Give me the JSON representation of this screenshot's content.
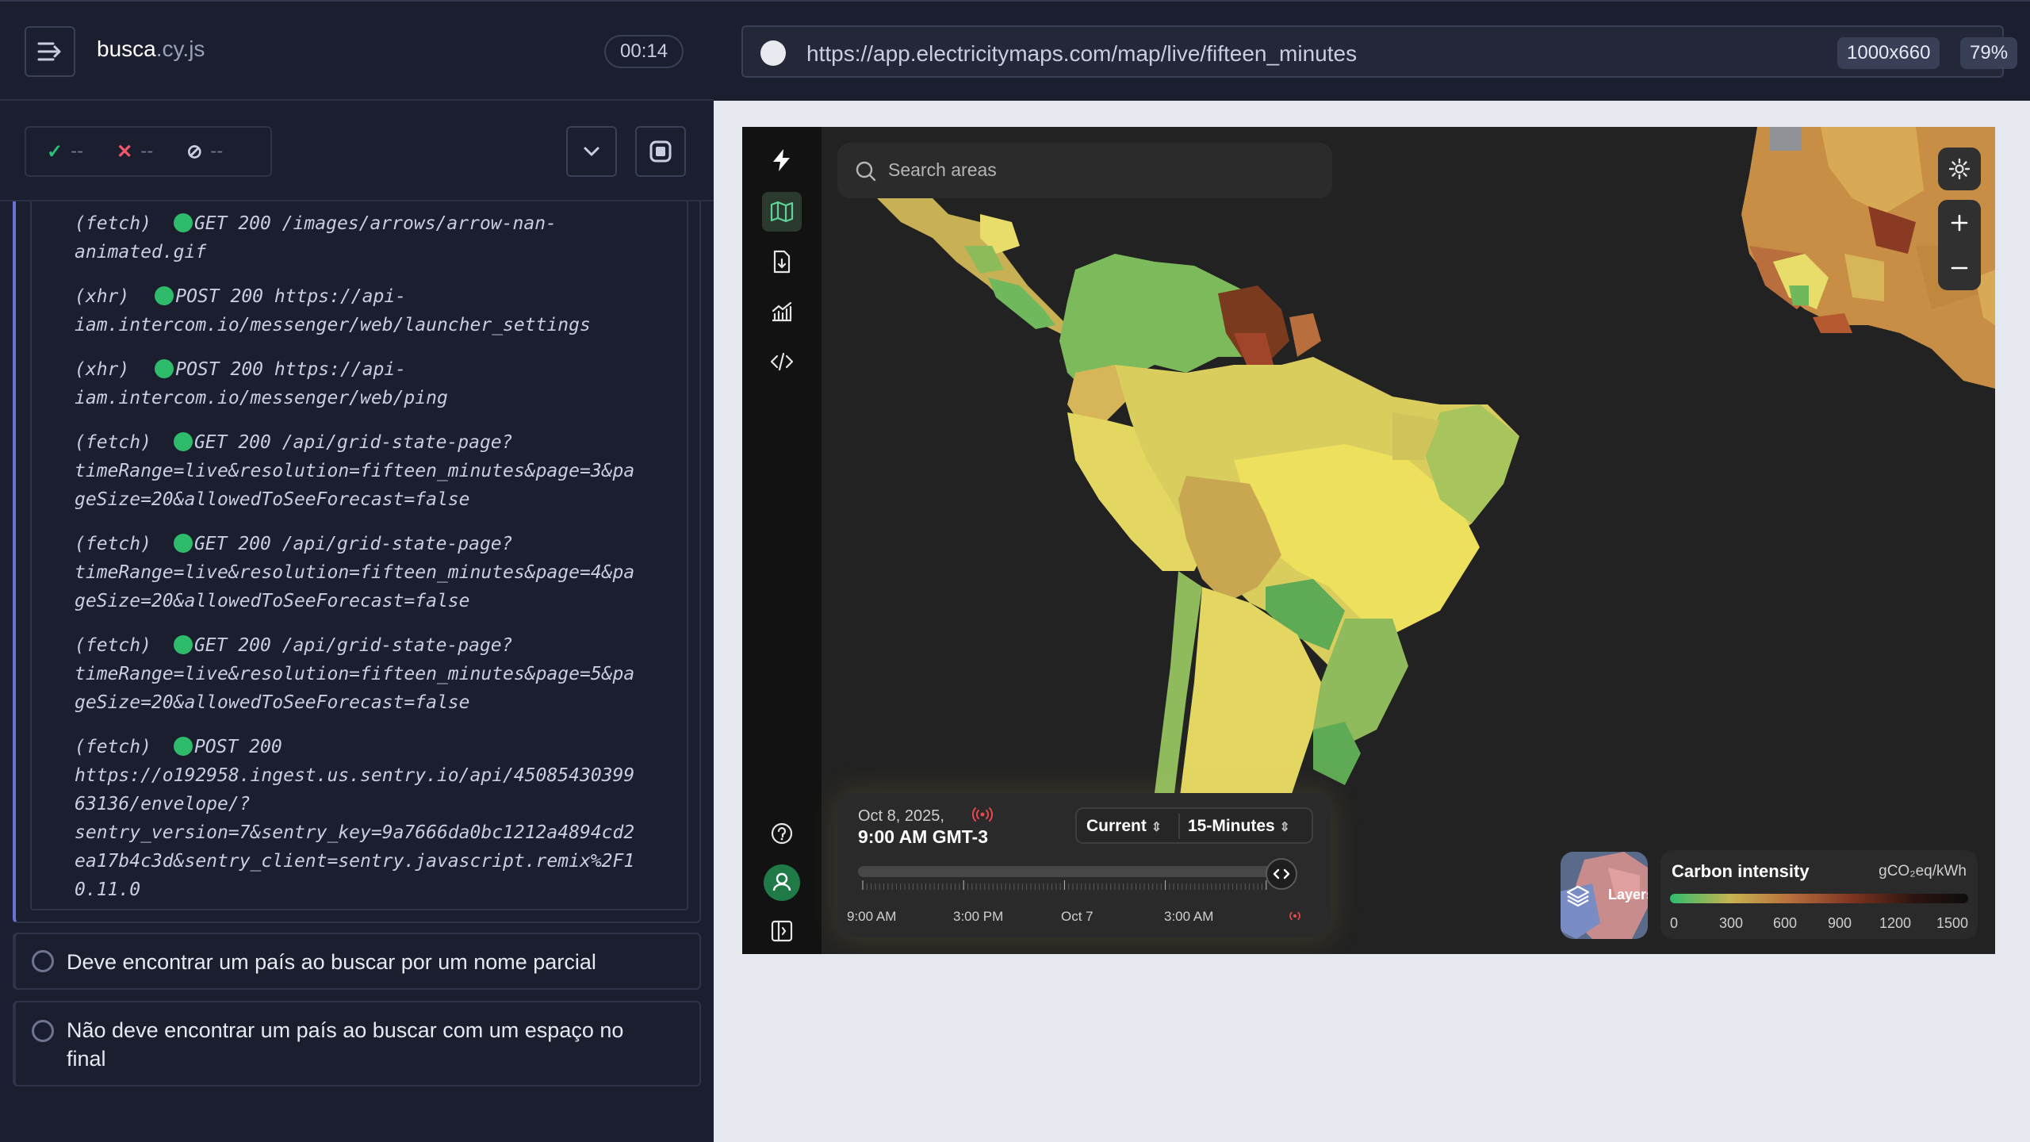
{
  "runner": {
    "spec_name": "busca",
    "spec_ext": ".cy.js",
    "timer": "00:14",
    "stats": {
      "passed": "--",
      "failed": "--",
      "pending": "--"
    },
    "log": [
      {
        "type": "(fetch)",
        "request": "GET 200 /images/arrows/arrow-nan-",
        "rest": [
          "animated.gif"
        ]
      },
      {
        "type": "(xhr)",
        "request": "POST 200 https://api-",
        "rest": [
          "iam.intercom.io/messenger/web/launcher_settings"
        ]
      },
      {
        "type": "(xhr)",
        "request": "POST 200 https://api-",
        "rest": [
          "iam.intercom.io/messenger/web/ping"
        ]
      },
      {
        "type": "(fetch)",
        "request": "GET 200 /api/grid-state-page?",
        "rest": [
          "timeRange=live&resolution=fifteen_minutes&page=3&pa",
          "geSize=20&allowedToSeeForecast=false"
        ]
      },
      {
        "type": "(fetch)",
        "request": "GET 200 /api/grid-state-page?",
        "rest": [
          "timeRange=live&resolution=fifteen_minutes&page=4&pa",
          "geSize=20&allowedToSeeForecast=false"
        ]
      },
      {
        "type": "(fetch)",
        "request": "GET 200 /api/grid-state-page?",
        "rest": [
          "timeRange=live&resolution=fifteen_minutes&page=5&pa",
          "geSize=20&allowedToSeeForecast=false"
        ]
      },
      {
        "type": "(fetch)",
        "request": "POST 200",
        "rest": [
          "https://o192958.ingest.us.sentry.io/api/45085430399",
          "63136/envelope/?",
          "sentry_version=7&sentry_key=9a7666da0bc1212a4894cd2",
          "ea17b4c3d&sentry_client=sentry.javascript.remix%2F1",
          "0.11.0"
        ]
      }
    ],
    "tests": [
      "Deve encontrar um país ao buscar por um nome parcial",
      "Não deve encontrar um país ao buscar com um espaço no final"
    ]
  },
  "browser": {
    "url": "https://app.electricitymaps.com/map/live/fifteen_minutes",
    "viewport": "1000x660",
    "zoom": "79%"
  },
  "app": {
    "search_placeholder": "Search areas",
    "date": "Oct 8, 2025,",
    "time": "9:00 AM GMT-3",
    "mode": "Current",
    "resolution": "15-Minutes",
    "time_labels": [
      "9:00 AM",
      "3:00 PM",
      "Oct 7",
      "3:00 AM"
    ],
    "layers_label": "Layers",
    "legend": {
      "title": "Carbon intensity",
      "unit": "gCO₂eq/kWh",
      "ticks": [
        "0",
        "300",
        "600",
        "900",
        "1200",
        "1500"
      ]
    },
    "colors": {
      "accent_green": "#2ebc6c",
      "runner_bg": "#1b1e2e",
      "map_bg": "#222222"
    }
  }
}
